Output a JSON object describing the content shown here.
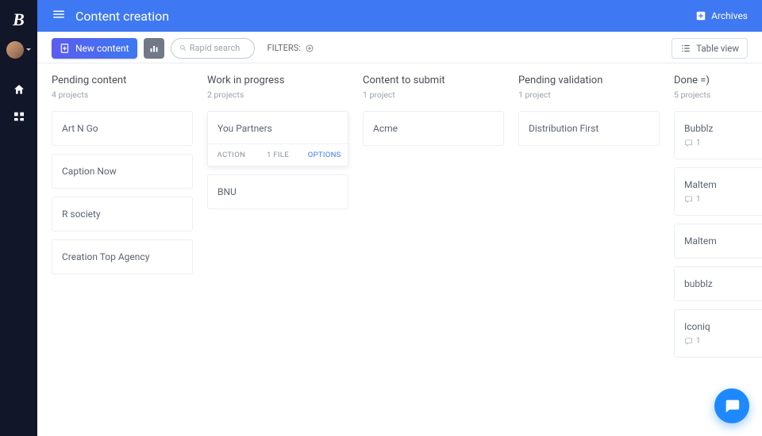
{
  "logo_glyph": "B",
  "header": {
    "title": "Content creation",
    "archives_label": "Archives"
  },
  "toolbar": {
    "new_label": "New content",
    "search_placeholder": "Rapid search",
    "filters_label": "FILTERS:",
    "table_view_label": "Table view"
  },
  "card_actions": {
    "action": "ACTION",
    "file": "1 FILE",
    "options": "OPTIONS"
  },
  "columns": [
    {
      "title": "Pending content",
      "count": "4 projects",
      "cards": [
        {
          "title": "Art N Go"
        },
        {
          "title": "Caption Now"
        },
        {
          "title": "R society"
        },
        {
          "title": "Creation Top Agency"
        }
      ]
    },
    {
      "title": "Work in progress",
      "count": "2 projects",
      "cards": [
        {
          "title": "You Partners",
          "expanded": true
        },
        {
          "title": "BNU"
        }
      ]
    },
    {
      "title": "Content to submit",
      "count": "1 project",
      "cards": [
        {
          "title": "Acme"
        }
      ]
    },
    {
      "title": "Pending validation",
      "count": "1 project",
      "cards": [
        {
          "title": "Distribution First"
        }
      ]
    },
    {
      "title": "Done =)",
      "count": "5 projects",
      "done": true,
      "cards": [
        {
          "title": "Bubblz",
          "comments": "1"
        },
        {
          "title": "Maltem",
          "comments": "1"
        },
        {
          "title": "Maltem"
        },
        {
          "title": "bubblz"
        },
        {
          "title": "Iconiq",
          "comments": "1"
        }
      ]
    }
  ]
}
